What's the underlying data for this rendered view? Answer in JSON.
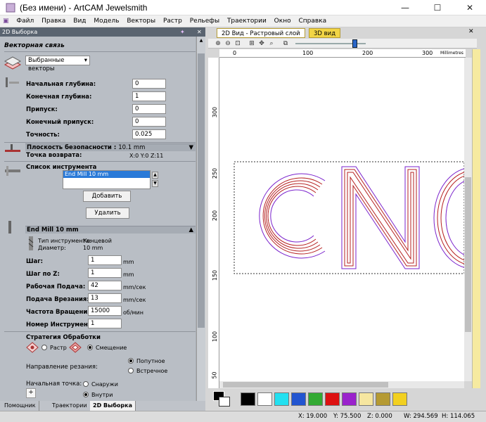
{
  "window": {
    "title": "(Без имени) - ArtCAM Jewelsmith",
    "min": "—",
    "max": "☐",
    "close": "✕"
  },
  "menu": [
    "Файл",
    "Правка",
    "Вид",
    "Модель",
    "Векторы",
    "Растр",
    "Рельефы",
    "Траектории",
    "Окно",
    "Справка"
  ],
  "panel": {
    "title": "2D Выборка",
    "vector_section": "Векторная связь",
    "vector_select": "Выбранные векторы",
    "fields": [
      {
        "label": "Начальная глубина:",
        "value": "0"
      },
      {
        "label": "Конечная глубина:",
        "value": "1"
      },
      {
        "label": "Припуск:",
        "value": "0"
      },
      {
        "label": "Конечный припуск:",
        "value": "0"
      },
      {
        "label": "Точность:",
        "value": "0.025"
      }
    ],
    "safe_plane_label": "Плоскость безопасности :",
    "safe_plane_value": "10.1 mm",
    "return_label": "Точка возврата:",
    "return_value": "X:0 Y:0 Z:11",
    "tool_list_label": "Список инструмента",
    "tool_list_items": [
      "End Mill 10 mm"
    ],
    "add_button": "Добавить",
    "delete_button": "Удалить",
    "tool_header": "End Mill 10 mm",
    "tool_type_label": "Тип инструмента:",
    "tool_type_value": "Концевой",
    "diameter_label": "Диаметр:",
    "diameter_value": "10 mm",
    "params": [
      {
        "label": "Шаг:",
        "value": "1",
        "unit": "mm"
      },
      {
        "label": "Шаг по Z:",
        "value": "1",
        "unit": "mm"
      },
      {
        "label": "Рабочая Подача:",
        "value": "42",
        "unit": "mm/сек"
      },
      {
        "label": "Подача Врезания:",
        "value": "13",
        "unit": "mm/сек"
      },
      {
        "label": "Частота Вращения:",
        "value": "15000",
        "unit": "об/мин"
      },
      {
        "label": "Номер Инструмента:",
        "value": "1",
        "unit": ""
      }
    ],
    "strategy_label": "Стратегия Обработки",
    "strategy_raster": "Растр",
    "strategy_offset": "Смещение",
    "cut_direction_label": "Направление резания:",
    "cut_climb": "Попутное",
    "cut_conventional": "Встречное",
    "start_point_label": "Начальная точка:",
    "start_outside": "Снаружи",
    "start_inside": "Внутри"
  },
  "bottom_tabs": [
    "Помощник",
    "Траектории",
    "2D Выборка"
  ],
  "doc_tabs": [
    "2D Вид - Растровый слой",
    "3D вид"
  ],
  "ruler": {
    "units": "Millimetres",
    "h_ticks": [
      "0",
      "100",
      "200",
      "300"
    ],
    "v_ticks": [
      "300",
      "250",
      "200",
      "150",
      "100",
      "50"
    ]
  },
  "palette": {
    "colors": [
      "#000000",
      "#ffffff",
      "#22e0f0",
      "#2255d0",
      "#33aa33",
      "#dd1111",
      "#9a22cc",
      "#f6e6a0",
      "#b59a33",
      "#f2d020"
    ]
  },
  "status": {
    "x": "X: 19.000",
    "y": "Y: 75.500",
    "z": "Z: 0.000",
    "w": "W: 294.569",
    "h": "H: 114.065"
  }
}
